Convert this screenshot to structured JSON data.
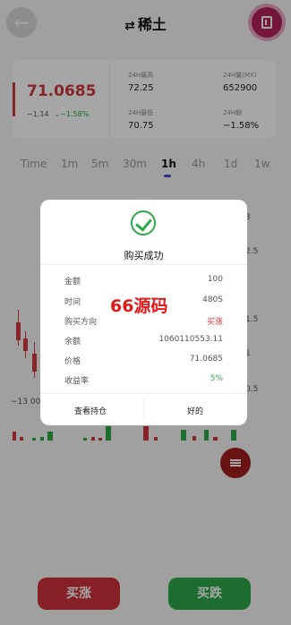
{
  "header": {
    "swap_glyph": "⇄",
    "title": "稀土"
  },
  "ticker": {
    "price": "71.0685",
    "change": "−1.14",
    "change_pct": "−1.58%",
    "stats": [
      {
        "label": "24H最高",
        "value": "72.25"
      },
      {
        "label": "24H量(MX)",
        "value": "652900"
      },
      {
        "label": "24H最低",
        "value": "70.75"
      },
      {
        "label": "24H额",
        "value": "−1.58%"
      }
    ]
  },
  "tabs": [
    "Time",
    "1m",
    "5m",
    "30m",
    "1h",
    "4h",
    "1d",
    "1w"
  ],
  "active_tab": "1h",
  "chart": {
    "right_axis": [
      "3",
      "2.5",
      "1.5",
      "1",
      "0.5"
    ],
    "x_label": "−13 00"
  },
  "modal": {
    "title": "购买成功",
    "rows": [
      {
        "label": "金额",
        "value": "100",
        "tone": "normal"
      },
      {
        "label": "时间",
        "value": "480S",
        "tone": "normal"
      },
      {
        "label": "购买方向",
        "value": "买涨",
        "tone": "red"
      },
      {
        "label": "余额",
        "value": "1060110553.11",
        "tone": "normal"
      },
      {
        "label": "价格",
        "value": "71.0685",
        "tone": "normal"
      },
      {
        "label": "收益率",
        "value": "5%",
        "tone": "green"
      }
    ],
    "watermark": "66源码",
    "left_button": "查看持仓",
    "right_button": "好的"
  },
  "actions": {
    "buy_up": "买涨",
    "buy_down": "买跌"
  },
  "colors": {
    "up": "#d03840",
    "down": "#2ea84a",
    "accent": "#b2245a"
  }
}
